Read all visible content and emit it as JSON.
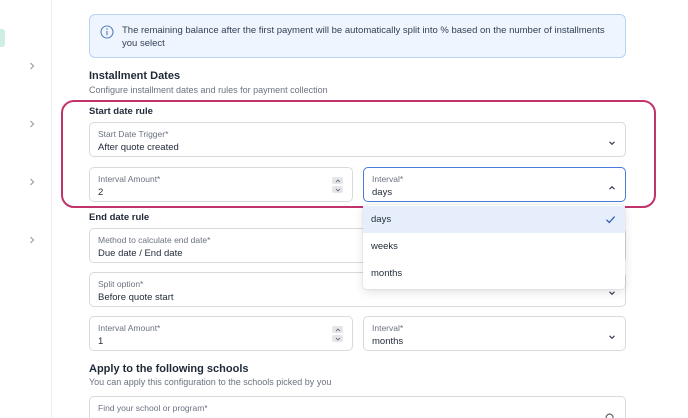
{
  "info_banner": {
    "text": "The remaining balance after the first payment will be automatically split into % based on the number of installments you select"
  },
  "installment_dates": {
    "title": "Installment Dates",
    "subtitle": "Configure installment dates and rules for payment collection"
  },
  "start_date_rule": {
    "title": "Start date rule",
    "trigger": {
      "label": "Start Date Trigger*",
      "value": "After quote created"
    },
    "interval_amount": {
      "label": "Interval Amount*",
      "value": "2"
    },
    "interval": {
      "label": "Interval*",
      "value": "days"
    }
  },
  "interval_menu": {
    "options": [
      "days",
      "weeks",
      "months"
    ],
    "selected": "days"
  },
  "end_date_rule": {
    "title": "End date rule",
    "method": {
      "label": "Method to calculate end date*",
      "value": "Due date / End date"
    },
    "split_option": {
      "label": "Split option*",
      "value": "Before quote start"
    },
    "interval_amount": {
      "label": "Interval Amount*",
      "value": "1"
    },
    "interval": {
      "label": "Interval*",
      "value": "months"
    }
  },
  "schools": {
    "title": "Apply to the following schools",
    "subtitle": "You can apply this configuration to the schools picked by you",
    "search": {
      "label": "Find your school or program*"
    }
  },
  "colors": {
    "highlight": "#c2336c",
    "focus": "#4b7bd8",
    "info_bg": "#eef5fe",
    "info_border": "#b7d3f4",
    "selected_bg": "#e6eefc"
  },
  "icons": {
    "rail": "chevron-right-icon",
    "info": "info-icon",
    "select": "chevron-down-icon",
    "open_select": "chevron-up-icon",
    "selected_option": "check-icon",
    "search": "search-icon"
  }
}
